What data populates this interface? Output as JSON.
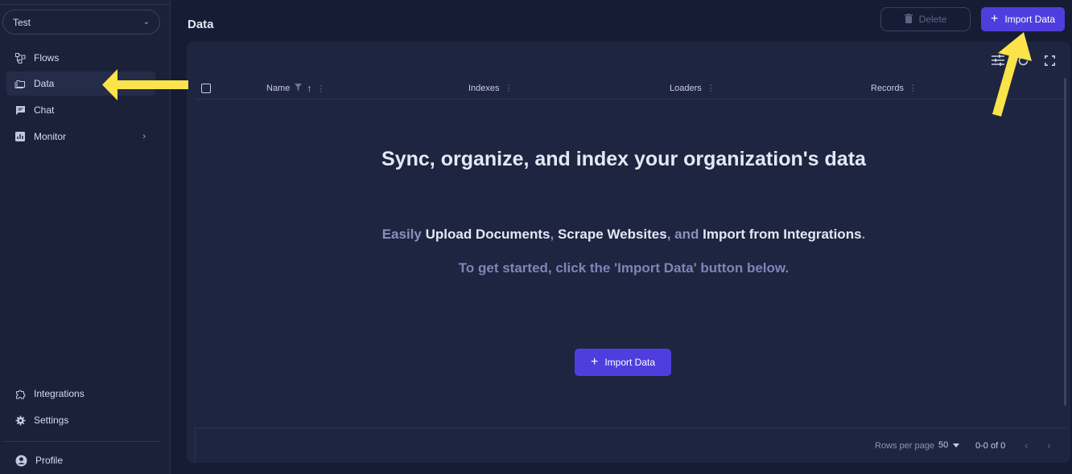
{
  "sidebar": {
    "workspace": "Test",
    "items": [
      {
        "label": "Flows",
        "icon": "flows-icon"
      },
      {
        "label": "Data",
        "icon": "data-folders-icon",
        "active": true
      },
      {
        "label": "Chat",
        "icon": "chat-icon"
      },
      {
        "label": "Monitor",
        "icon": "monitor-chart-icon",
        "has_submenu": true
      }
    ],
    "bottom_items": [
      {
        "label": "Integrations",
        "icon": "puzzle-icon"
      },
      {
        "label": "Settings",
        "icon": "gear-icon"
      }
    ],
    "profile": {
      "label": "Profile",
      "icon": "user-icon"
    }
  },
  "header": {
    "title": "Data",
    "delete_label": "Delete",
    "import_label": "Import Data"
  },
  "table": {
    "columns": [
      {
        "label": "Name",
        "sorted": "ascending",
        "filterable": true
      },
      {
        "label": "Indexes"
      },
      {
        "label": "Loaders"
      },
      {
        "label": "Records"
      }
    ],
    "toolbar_icons": [
      "tune-icon",
      "refresh-icon",
      "fullscreen-icon"
    ]
  },
  "empty_state": {
    "title": "Sync, organize, and index your organization's data",
    "line1": {
      "easily": "Easily",
      "upload": "Upload Documents",
      "comma1": ",",
      "scrape": "Scrape Websites",
      "and": ", and",
      "import": "Import from Integrations",
      "period": "."
    },
    "line2": "To get started, click the 'Import Data' button below.",
    "button_label": "Import Data"
  },
  "footer": {
    "rows_per_page_label": "Rows per page",
    "rows_per_page_value": "50",
    "range": "0-0 of 0"
  },
  "colors": {
    "accent": "#4f3ede",
    "annotation": "#fbe34a",
    "background": "#161c33",
    "panel": "#1e2540"
  }
}
